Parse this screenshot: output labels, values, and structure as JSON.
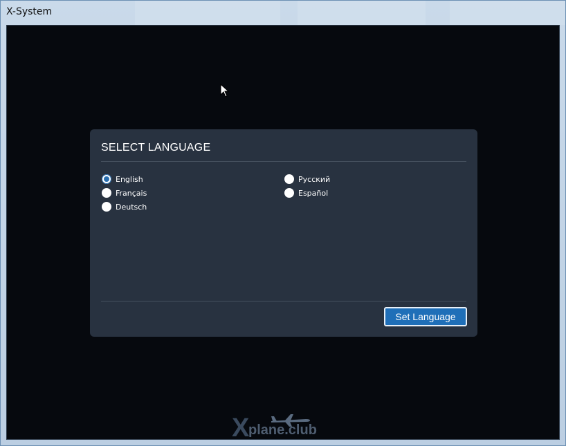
{
  "window": {
    "title": "X-System"
  },
  "dialog": {
    "title": "SELECT LANGUAGE",
    "languages": [
      {
        "label": "English",
        "selected": true
      },
      {
        "label": "Français",
        "selected": false
      },
      {
        "label": "Deutsch",
        "selected": false
      },
      {
        "label": "Русский",
        "selected": false
      },
      {
        "label": "Español",
        "selected": false
      }
    ],
    "set_button_label": "Set Language"
  },
  "footer": {
    "logo_text": "plane.club",
    "logo_letter": "X"
  },
  "colors": {
    "client_background": "#06090e",
    "dialog_background": "#283240",
    "accent": "#1f6fb8"
  }
}
